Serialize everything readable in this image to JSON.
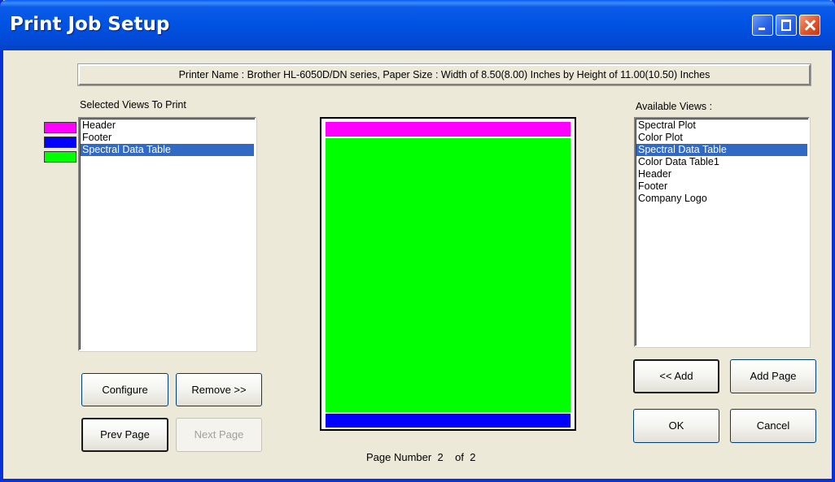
{
  "window": {
    "title": "Print Job Setup"
  },
  "printer_info": "Printer Name : Brother HL-6050D/DN series, Paper Size : Width of 8.50(8.00) Inches by Height of 11.00(10.50) Inches",
  "selected_views": {
    "label": "Selected Views To Print",
    "items": [
      {
        "label": "Header",
        "color": "#ff00ff",
        "selected": false
      },
      {
        "label": "Footer",
        "color": "#0000ff",
        "selected": false
      },
      {
        "label": "Spectral Data Table",
        "color": "#00ff00",
        "selected": true
      }
    ]
  },
  "available_views": {
    "label": "Available Views :",
    "items": [
      {
        "label": "Spectral Plot",
        "selected": false
      },
      {
        "label": "Color Plot",
        "selected": false
      },
      {
        "label": "Spectral Data Table",
        "selected": true
      },
      {
        "label": "Color Data Table1",
        "selected": false
      },
      {
        "label": "Header",
        "selected": false
      },
      {
        "label": "Footer",
        "selected": false
      },
      {
        "label": "Company Logo",
        "selected": false
      }
    ]
  },
  "buttons": {
    "configure": "Configure",
    "remove": "Remove >>",
    "prev_page": "Prev Page",
    "next_page": "Next Page",
    "add": "<< Add",
    "add_page": "Add Page",
    "ok": "OK",
    "cancel": "Cancel"
  },
  "page_number": {
    "label": "Page Number",
    "current": "2",
    "of_label": "of",
    "total": "2"
  },
  "preview_colors": {
    "header": "#ff00ff",
    "table": "#00ff00",
    "footer": "#0000ff"
  }
}
